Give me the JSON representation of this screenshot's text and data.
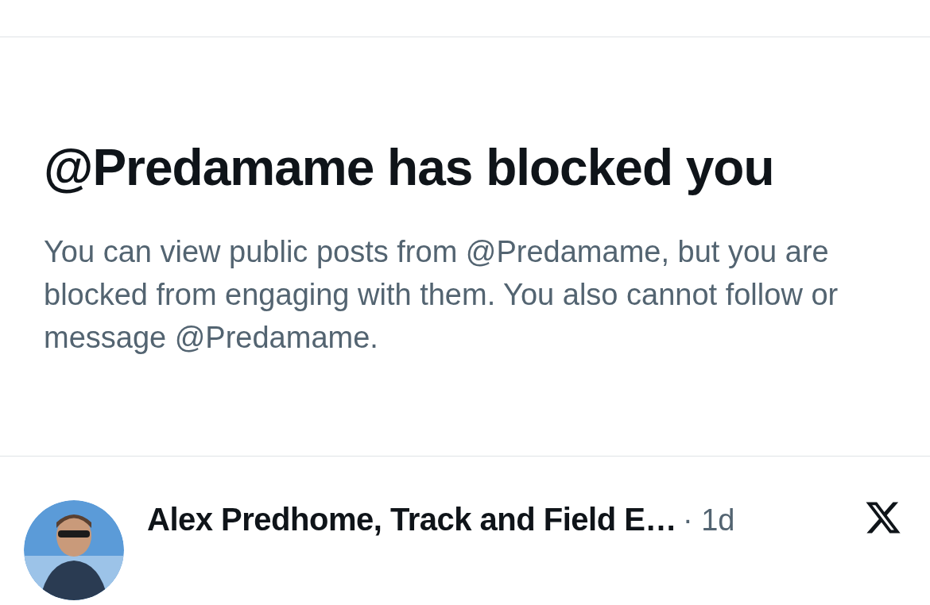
{
  "notice": {
    "title": "@Predamame has blocked you",
    "body": "You can view public posts from @Predamame, but you are blocked from engaging with them. You also cannot follow or message @Predamame."
  },
  "post": {
    "author": "Alex Predhome, Track and Field E…",
    "time": "· 1d"
  }
}
